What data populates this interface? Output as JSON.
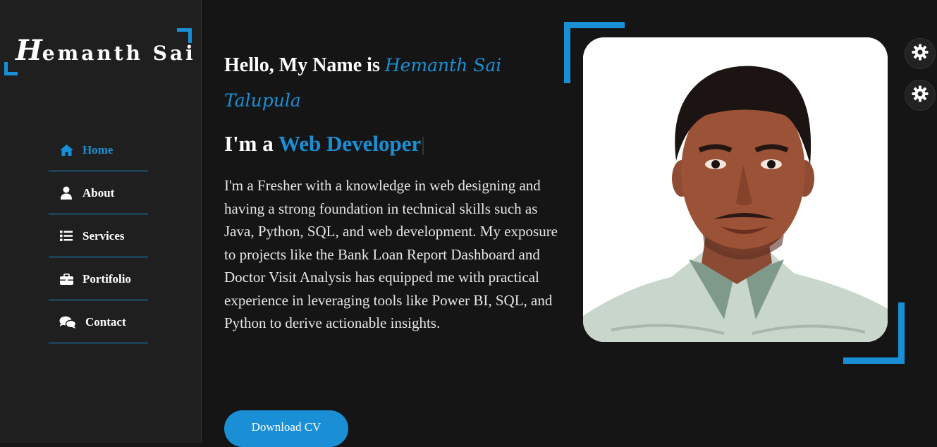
{
  "sidebar": {
    "logo_initial": "H",
    "logo_rest": "emanth Sai",
    "items": [
      {
        "label": "Home",
        "icon": "home-icon",
        "active": true
      },
      {
        "label": "About",
        "icon": "user-icon",
        "active": false
      },
      {
        "label": "Services",
        "icon": "list-icon",
        "active": false
      },
      {
        "label": "Portifolio",
        "icon": "briefcase-icon",
        "active": false
      },
      {
        "label": "Contact",
        "icon": "comments-icon",
        "active": false
      }
    ]
  },
  "hero": {
    "hello_prefix": "Hello, My Name is ",
    "name": "Hemanth Sai Talupula",
    "role_prefix": "I'm a ",
    "role": "Web Developer",
    "description": "I'm a Fresher with a knowledge in web designing and having a strong foundation in technical skills such as Java, Python, SQL, and web development. My exposure to projects like the Bank Loan Report Dashboard and Doctor Visit Analysis has equipped me with practical experience in leveraging tools like Power BI, SQL, and Python to derive actionable insights.",
    "cta_label": "Download CV"
  },
  "theme_toggles": [
    {
      "icon": "gear-icon"
    },
    {
      "icon": "gear-icon"
    }
  ],
  "colors": {
    "accent": "#1a8fd6",
    "background": "#151515",
    "sidebar": "#1f1f1f"
  }
}
